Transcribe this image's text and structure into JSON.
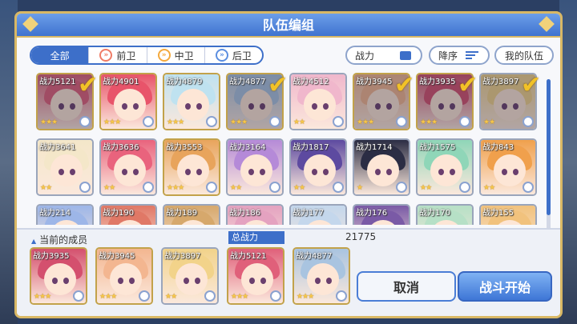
{
  "title": "队伍编组",
  "tabs": [
    {
      "label": "全部",
      "icon": ""
    },
    {
      "label": "前卫",
      "icon": "front-role-icon"
    },
    {
      "label": "中卫",
      "icon": "mid-role-icon"
    },
    {
      "label": "后卫",
      "icon": "back-role-icon"
    }
  ],
  "sort_label": "战力",
  "order_label": "降序",
  "my_team_label": "我的队伍",
  "current_members_label": "当前的成员",
  "total_power_label": "总战力",
  "total_power": "21775",
  "cancel_label": "取消",
  "start_label": "战斗开始",
  "roster": [
    {
      "power": "战力5121",
      "stars": "★★★",
      "selected": true
    },
    {
      "power": "战力4901",
      "stars": "★★★",
      "selected": false
    },
    {
      "power": "战力4879",
      "stars": "★★★",
      "selected": false
    },
    {
      "power": "战力4877",
      "stars": "★★★",
      "selected": true
    },
    {
      "power": "战力4512",
      "stars": "★★",
      "selected": false
    },
    {
      "power": "战力3945",
      "stars": "★★★",
      "selected": true
    },
    {
      "power": "战力3935",
      "stars": "★★★",
      "selected": true
    },
    {
      "power": "战力3897",
      "stars": "★★",
      "selected": true
    },
    {
      "power": "战力3641",
      "stars": "★★",
      "selected": false
    },
    {
      "power": "战力3636",
      "stars": "★★",
      "selected": false
    },
    {
      "power": "战力3553",
      "stars": "★★★",
      "selected": false
    },
    {
      "power": "战力3164",
      "stars": "★★",
      "selected": false
    },
    {
      "power": "战力1817",
      "stars": "★★",
      "selected": false
    },
    {
      "power": "战力1714",
      "stars": "★",
      "selected": false
    },
    {
      "power": "战力1575",
      "stars": "★★",
      "selected": false
    },
    {
      "power": "战力843",
      "stars": "★★",
      "selected": false
    },
    {
      "power": "战力214",
      "stars": "",
      "selected": false
    },
    {
      "power": "战力190",
      "stars": "",
      "selected": false
    },
    {
      "power": "战力189",
      "stars": "",
      "selected": false
    },
    {
      "power": "战力186",
      "stars": "",
      "selected": false
    },
    {
      "power": "战力177",
      "stars": "",
      "selected": false
    },
    {
      "power": "战力176",
      "stars": "",
      "selected": false
    },
    {
      "power": "战力170",
      "stars": "",
      "selected": false
    },
    {
      "power": "战力155",
      "stars": "",
      "selected": false
    }
  ],
  "team": [
    {
      "power": "战力3935",
      "stars": "★★★"
    },
    {
      "power": "战力3945",
      "stars": "★★★"
    },
    {
      "power": "战力3897",
      "stars": "★★"
    },
    {
      "power": "战力5121",
      "stars": "★★★"
    },
    {
      "power": "战力4877",
      "stars": "★★★"
    }
  ],
  "colors": {
    "accent": "#3d6fc9",
    "gold_border": "#d9b865",
    "check": "#f2c227"
  }
}
